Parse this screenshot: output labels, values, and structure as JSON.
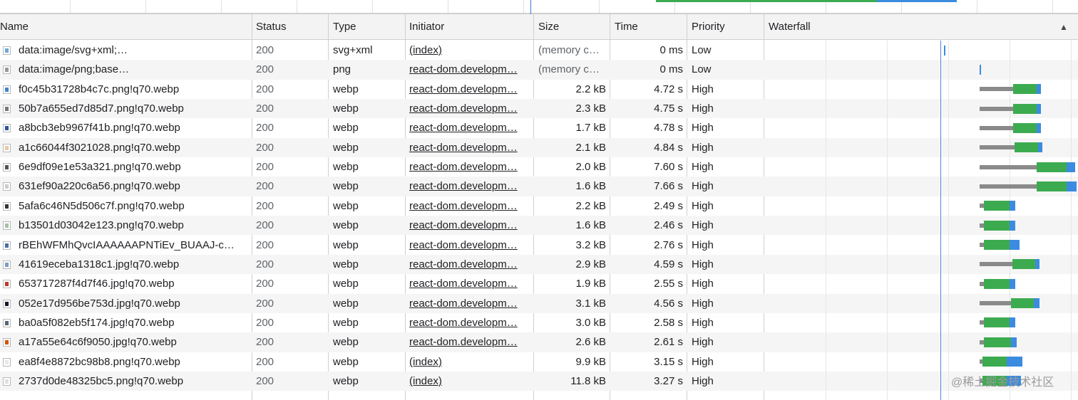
{
  "header": {
    "name": "Name",
    "status": "Status",
    "type": "Type",
    "initiator": "Initiator",
    "size": "Size",
    "time": "Time",
    "priority": "Priority",
    "waterfall": "Waterfall",
    "sort_icon": "▲"
  },
  "rows": [
    {
      "name": "data:image/svg+xml;…",
      "status": "200",
      "type": "svg+xml",
      "initiator": "(index)",
      "size": "(memory c…",
      "time": "0 ms",
      "priority": "Low"
    },
    {
      "name": "data:image/png;base…",
      "status": "200",
      "type": "png",
      "initiator": "react-dom.developm…",
      "size": "(memory c…",
      "time": "0 ms",
      "priority": "Low"
    },
    {
      "name": "f0c45b31728b4c7c.png!q70.webp",
      "status": "200",
      "type": "webp",
      "initiator": "react-dom.developm…",
      "size": "2.2 kB",
      "time": "4.72 s",
      "priority": "High"
    },
    {
      "name": "50b7a655ed7d85d7.png!q70.webp",
      "status": "200",
      "type": "webp",
      "initiator": "react-dom.developm…",
      "size": "2.3 kB",
      "time": "4.75 s",
      "priority": "High"
    },
    {
      "name": "a8bcb3eb9967f41b.png!q70.webp",
      "status": "200",
      "type": "webp",
      "initiator": "react-dom.developm…",
      "size": "1.7 kB",
      "time": "4.78 s",
      "priority": "High"
    },
    {
      "name": "a1c66044f3021028.png!q70.webp",
      "status": "200",
      "type": "webp",
      "initiator": "react-dom.developm…",
      "size": "2.1 kB",
      "time": "4.84 s",
      "priority": "High"
    },
    {
      "name": "6e9df09e1e53a321.png!q70.webp",
      "status": "200",
      "type": "webp",
      "initiator": "react-dom.developm…",
      "size": "2.0 kB",
      "time": "7.60 s",
      "priority": "High"
    },
    {
      "name": "631ef90a220c6a56.png!q70.webp",
      "status": "200",
      "type": "webp",
      "initiator": "react-dom.developm…",
      "size": "1.6 kB",
      "time": "7.66 s",
      "priority": "High"
    },
    {
      "name": "5afa6c46N5d506c7f.png!q70.webp",
      "status": "200",
      "type": "webp",
      "initiator": "react-dom.developm…",
      "size": "2.2 kB",
      "time": "2.49 s",
      "priority": "High"
    },
    {
      "name": "b13501d03042e123.png!q70.webp",
      "status": "200",
      "type": "webp",
      "initiator": "react-dom.developm…",
      "size": "1.6 kB",
      "time": "2.46 s",
      "priority": "High"
    },
    {
      "name": "rBEhWFMhQvcIAAAAAAPNTiEv_BUAAJ-c…",
      "status": "200",
      "type": "webp",
      "initiator": "react-dom.developm…",
      "size": "3.2 kB",
      "time": "2.76 s",
      "priority": "High"
    },
    {
      "name": "41619eceba1318c1.jpg!q70.webp",
      "status": "200",
      "type": "webp",
      "initiator": "react-dom.developm…",
      "size": "2.9 kB",
      "time": "4.59 s",
      "priority": "High"
    },
    {
      "name": "653717287f4d7f46.jpg!q70.webp",
      "status": "200",
      "type": "webp",
      "initiator": "react-dom.developm…",
      "size": "1.9 kB",
      "time": "2.55 s",
      "priority": "High"
    },
    {
      "name": "052e17d956be753d.jpg!q70.webp",
      "status": "200",
      "type": "webp",
      "initiator": "react-dom.developm…",
      "size": "3.1 kB",
      "time": "4.56 s",
      "priority": "High"
    },
    {
      "name": "ba0a5f082eb5f174.jpg!q70.webp",
      "status": "200",
      "type": "webp",
      "initiator": "react-dom.developm…",
      "size": "3.0 kB",
      "time": "2.58 s",
      "priority": "High"
    },
    {
      "name": "a17a55e64c6f9050.jpg!q70.webp",
      "status": "200",
      "type": "webp",
      "initiator": "react-dom.developm…",
      "size": "2.6 kB",
      "time": "2.61 s",
      "priority": "High"
    },
    {
      "name": "ea8f4e8872bc98b8.png!q70.webp",
      "status": "200",
      "type": "webp",
      "initiator": "(index)",
      "size": "9.9 kB",
      "time": "3.15 s",
      "priority": "High"
    },
    {
      "name": "2737d0de48325bc5.png!q70.webp",
      "status": "200",
      "type": "webp",
      "initiator": "(index)",
      "size": "11.8 kB",
      "time": "3.27 s",
      "priority": "High"
    }
  ],
  "icon_colors": [
    "#6fa8dc",
    "#999999",
    "#3d85c6",
    "#777777",
    "#2b5797",
    "#e6c9a8",
    "#555555",
    "#cccccc",
    "#333333",
    "#a4c2a5",
    "#4a6fa5",
    "#7a9cc6",
    "#c0392b",
    "#1a1a2e",
    "#556677",
    "#d35400",
    "#e8e8e8",
    "#e0e0e0"
  ],
  "colors": {
    "waiting": "#8a8a8a",
    "download": "#3cab4f",
    "content": "#3b8be0"
  },
  "watermark": "@稀土掘金技术社区"
}
